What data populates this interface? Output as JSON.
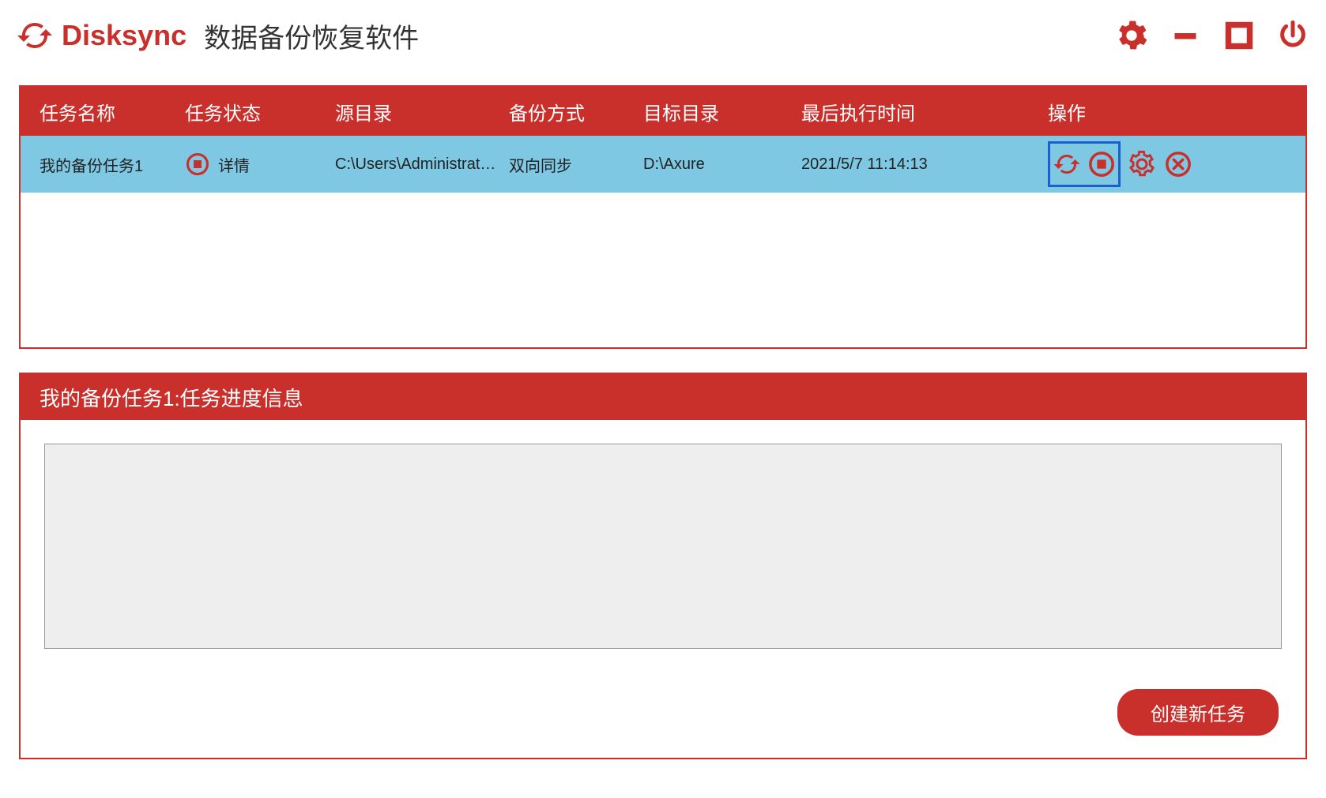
{
  "app": {
    "name": "Disksync",
    "subtitle": "数据备份恢复软件"
  },
  "table": {
    "headers": {
      "name": "任务名称",
      "status": "任务状态",
      "source": "源目录",
      "mode": "备份方式",
      "target": "目标目录",
      "time": "最后执行时间",
      "actions": "操作"
    },
    "row": {
      "name": "我的备份任务1",
      "status_label": "详情",
      "source": "C:\\Users\\Administrato...",
      "mode": "双向同步",
      "target": "D:\\Axure",
      "time": "2021/5/7 11:14:13"
    }
  },
  "progress": {
    "title": "我的备份任务1:任务进度信息"
  },
  "buttons": {
    "create": "创建新任务"
  }
}
